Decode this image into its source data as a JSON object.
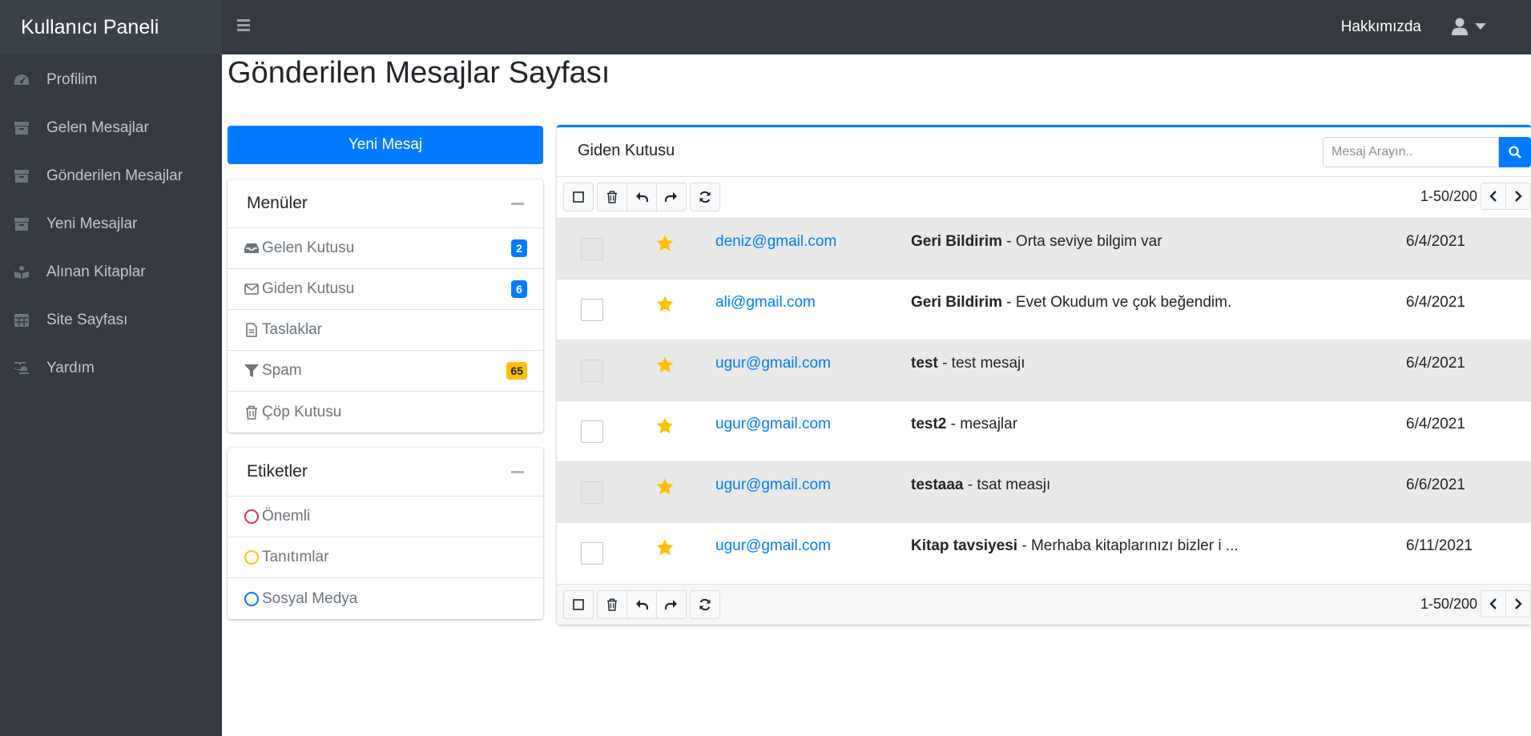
{
  "app": {
    "brand": "Kullanıcı Paneli",
    "nav_about": "Hakkımızda"
  },
  "sidebar": {
    "items": [
      {
        "label": "Profilim",
        "icon": "dashboard-icon"
      },
      {
        "label": "Gelen Mesajlar",
        "icon": "box-icon"
      },
      {
        "label": "Gönderilen Mesajlar",
        "icon": "box-icon"
      },
      {
        "label": "Yeni Mesajlar",
        "icon": "box-icon"
      },
      {
        "label": "Alınan Kitaplar",
        "icon": "book-reader-icon"
      },
      {
        "label": "Site Sayfası",
        "icon": "table-icon"
      },
      {
        "label": "Yardım",
        "icon": "helicopter-icon"
      }
    ]
  },
  "page": {
    "title": "Gönderilen Mesajlar Sayfası"
  },
  "compose": {
    "label": "Yeni Mesaj"
  },
  "menus": {
    "title": "Menüler",
    "items": [
      {
        "label": "Gelen Kutusu",
        "icon": "inbox-icon",
        "badge": "2",
        "badge_color": "#007bff"
      },
      {
        "label": "Giden Kutusu",
        "icon": "envelope-icon",
        "badge": "6",
        "badge_color": "#007bff"
      },
      {
        "label": "Taslaklar",
        "icon": "file-icon"
      },
      {
        "label": "Spam",
        "icon": "filter-icon",
        "badge": "65",
        "badge_color": "#ffc107"
      },
      {
        "label": "Çöp Kutusu",
        "icon": "trash-icon"
      }
    ]
  },
  "labels": {
    "title": "Etiketler",
    "items": [
      {
        "label": "Önemli",
        "color": "#dc3545"
      },
      {
        "label": "Tanıtımlar",
        "color": "#ffc107"
      },
      {
        "label": "Sosyal Medya",
        "color": "#007bff"
      }
    ]
  },
  "mailbox": {
    "title": "Giden Kutusu",
    "search_placeholder": "Mesaj Arayın..",
    "pager_text": "1-50/200",
    "messages": [
      {
        "from": "deniz@gmail.com",
        "subject": "Geri Bildirim",
        "preview": " - Orta seviye bilgim var",
        "date": "6/4/2021"
      },
      {
        "from": "ali@gmail.com",
        "subject": "Geri Bildirim",
        "preview": " - Evet Okudum ve çok beğendim.",
        "date": "6/4/2021"
      },
      {
        "from": "ugur@gmail.com",
        "subject": "test",
        "preview": " - test mesajı",
        "date": "6/4/2021"
      },
      {
        "from": "ugur@gmail.com",
        "subject": "test2",
        "preview": " - mesajlar",
        "date": "6/4/2021"
      },
      {
        "from": "ugur@gmail.com",
        "subject": "testaaa",
        "preview": " - tsat measjı",
        "date": "6/6/2021"
      },
      {
        "from": "ugur@gmail.com",
        "subject": "Kitap tavsiyesi",
        "preview": " - Merhaba kitaplarınızı bizler i ...",
        "date": "6/11/2021"
      }
    ]
  },
  "colors": {
    "primary": "#007bff",
    "sidebar_bg": "#343a40",
    "star": "#ffc107"
  }
}
